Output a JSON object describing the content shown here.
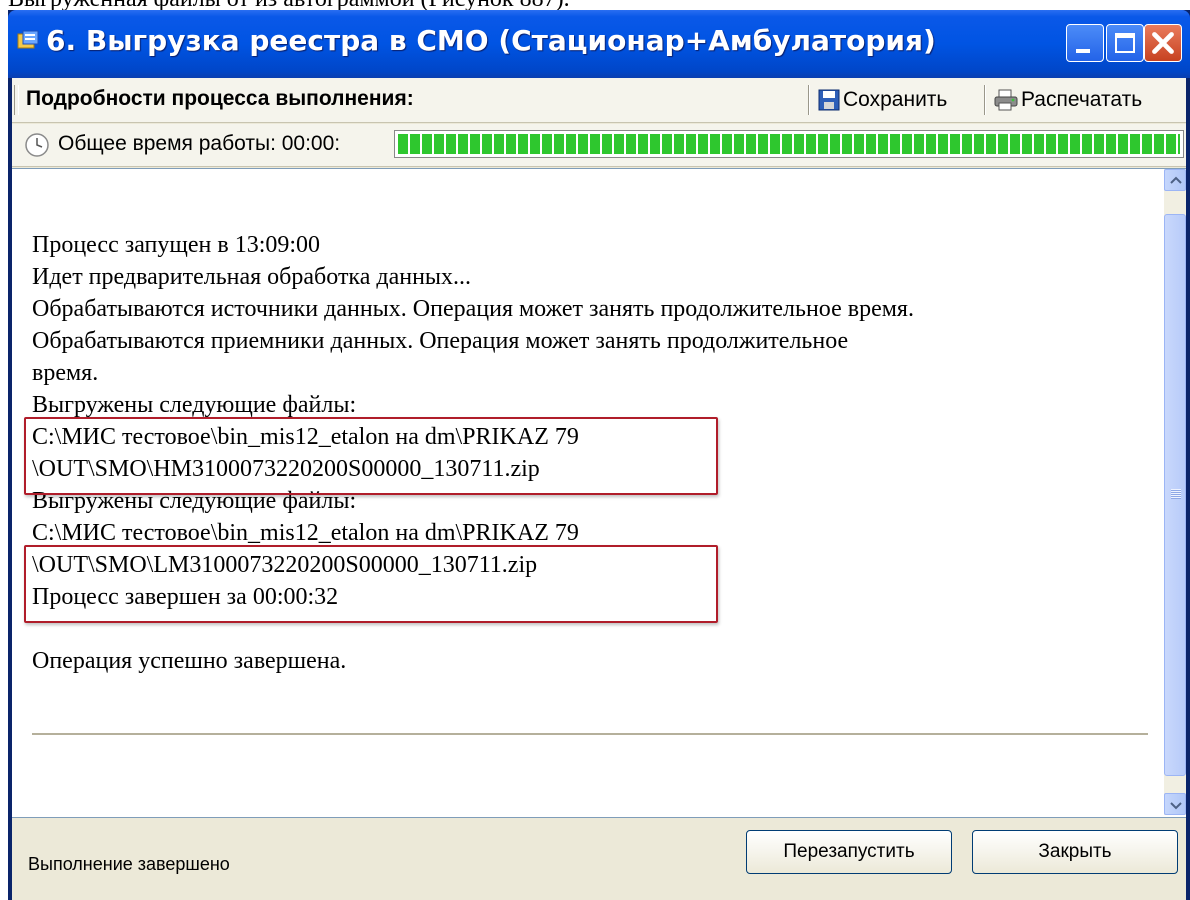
{
  "document_cutoff_text": "Выгруженная файлы от из автограммой (Рисунок 887).",
  "window": {
    "title": "6. Выгрузка реестра в СМО (Стационар+Амбулатория)"
  },
  "toolbar": {
    "details_label": "Подробности процесса выполнения:",
    "save_label": "Сохранить",
    "print_label": "Распечатать"
  },
  "progress": {
    "time_label": "Общее время работы: 00:00:",
    "fill_fraction": 1.0,
    "color": "#2ec72e"
  },
  "log": {
    "lines": [
      "Процесс запущен в 13:09:00",
      "Идет предварительная обработка данных...",
      "Обрабатываются источники данных. Операция может занять продолжительное время.",
      "Обрабатываются приемники данных. Операция может занять продолжительное",
      "время.",
      "Выгружены следующие файлы:",
      "C:\\МИС тестовое\\bin_mis12_etalon на dm\\PRIKAZ 79",
      "\\OUT\\SMO\\HM3100073220200S00000_130711.zip",
      "Выгружены следующие файлы:",
      "C:\\МИС тестовое\\bin_mis12_etalon на dm\\PRIKAZ 79",
      "\\OUT\\SMO\\LM3100073220200S00000_130711.zip",
      "Процесс завершен за 00:00:32",
      "",
      "Операция успешно завершена."
    ]
  },
  "footer": {
    "status": "Выполнение завершено",
    "restart_label": "Перезапустить",
    "close_label": "Закрыть"
  },
  "colors": {
    "titlebar": "#0054e3",
    "highlight_box": "#b01d2a"
  }
}
